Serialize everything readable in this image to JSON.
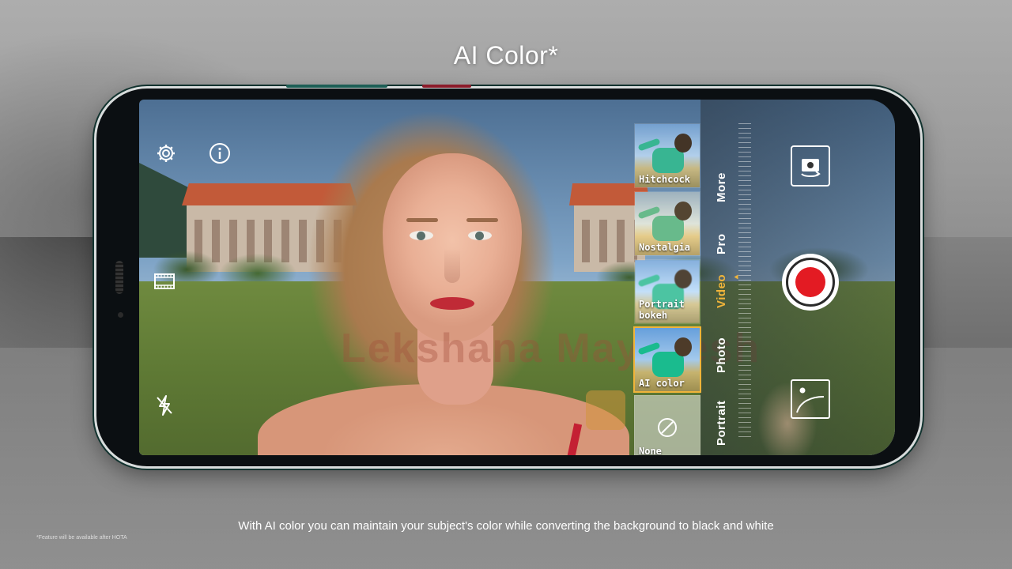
{
  "header": {
    "title": "AI Color*"
  },
  "camera": {
    "filters": [
      {
        "label": "Hitchcock",
        "selected": false
      },
      {
        "label": "Nostalgia",
        "selected": false
      },
      {
        "label": "Portrait bokeh",
        "selected": false
      },
      {
        "label": "AI color",
        "selected": true
      },
      {
        "label": "None",
        "selected": false
      }
    ],
    "modes": [
      "More",
      "Pro",
      "Video",
      "Photo",
      "Portrait"
    ],
    "active_mode": "Video",
    "icons": {
      "settings": "gear-icon",
      "info": "info-icon",
      "video_format": "film-icon",
      "flash": "flash-off-icon",
      "switch_camera": "switch-camera-icon",
      "record": "record-icon",
      "gallery": "gallery-icon",
      "none_filter": "none-icon"
    },
    "watermark": "Lekshana Mayuresh"
  },
  "footer": {
    "caption": "With AI color you can maintain your subject's color while converting the background to black and white",
    "footnote": "*Feature will be available after HOTA"
  },
  "colors": {
    "accent": "#f0b43a",
    "record": "#e31b23"
  }
}
